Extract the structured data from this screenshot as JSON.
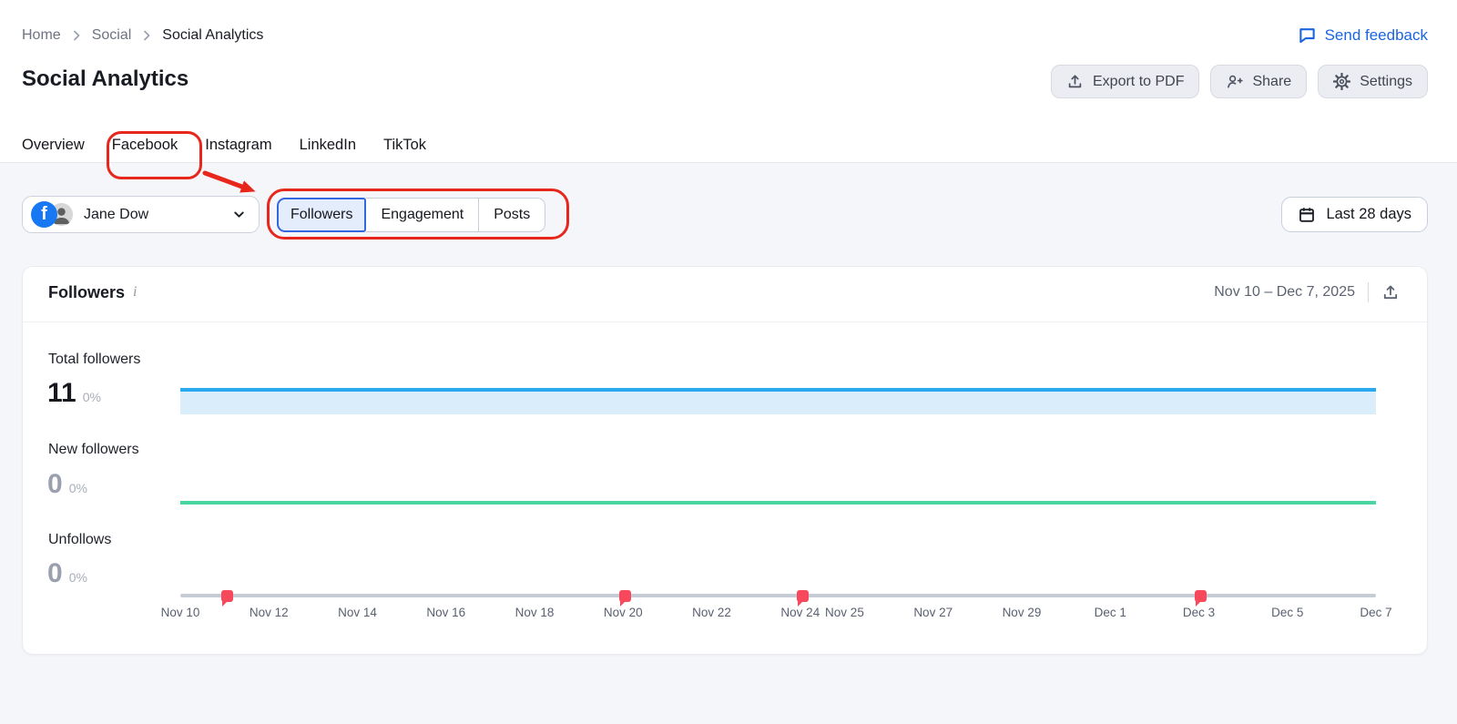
{
  "breadcrumb": {
    "items": [
      "Home",
      "Social",
      "Social Analytics"
    ]
  },
  "feedback": {
    "label": "Send feedback"
  },
  "header": {
    "title": "Social Analytics",
    "actions": [
      {
        "label": "Export to PDF",
        "icon": "export-pdf-icon"
      },
      {
        "label": "Share",
        "icon": "share-person-plus-icon"
      },
      {
        "label": "Settings",
        "icon": "gear-icon"
      }
    ]
  },
  "tabs": {
    "items": [
      {
        "label": "Overview",
        "active": false
      },
      {
        "label": "Facebook",
        "active": true
      },
      {
        "label": "Instagram",
        "active": false
      },
      {
        "label": "LinkedIn",
        "active": false
      },
      {
        "label": "TikTok",
        "active": false
      }
    ]
  },
  "toolbar": {
    "account": {
      "name": "Jane Dow",
      "network": "Facebook"
    },
    "metric_tabs": [
      {
        "label": "Followers",
        "selected": true
      },
      {
        "label": "Engagement",
        "selected": false
      },
      {
        "label": "Posts",
        "selected": false
      }
    ],
    "date_filter": "Last 28 days"
  },
  "annotations": {
    "color": "#e8271c",
    "highlighted": [
      "Facebook tab",
      "Followers | Engagement | Posts toggle"
    ],
    "arrow": "from Facebook tab to metric toggle"
  },
  "card": {
    "title": "Followers",
    "date_range": "Nov 10 – Dec 7, 2025"
  },
  "metrics": [
    {
      "label": "Total followers",
      "value": "11",
      "change": "0%"
    },
    {
      "label": "New followers",
      "value": "0",
      "change": "0%"
    },
    {
      "label": "Unfollows",
      "value": "0",
      "change": "0%"
    }
  ],
  "chart_data": {
    "type": "line",
    "title": "Followers",
    "date_range": "Nov 10 – Dec 7, 2025",
    "x_span_days": 27,
    "x_ticks": [
      {
        "label": "Nov 10",
        "day": 0
      },
      {
        "label": "Nov 12",
        "day": 2
      },
      {
        "label": "Nov 14",
        "day": 4
      },
      {
        "label": "Nov 16",
        "day": 6
      },
      {
        "label": "Nov 18",
        "day": 8
      },
      {
        "label": "Nov 20",
        "day": 10
      },
      {
        "label": "Nov 22",
        "day": 12
      },
      {
        "label": "Nov 24",
        "day": 14
      },
      {
        "label": "Nov 25",
        "day": 15
      },
      {
        "label": "Nov 27",
        "day": 17
      },
      {
        "label": "Nov 29",
        "day": 19
      },
      {
        "label": "Dec 1",
        "day": 21
      },
      {
        "label": "Dec 3",
        "day": 23
      },
      {
        "label": "Dec 5",
        "day": 25
      },
      {
        "label": "Dec 7",
        "day": 27
      }
    ],
    "series": [
      {
        "name": "Total followers",
        "constant_value": 11,
        "change": "0%",
        "color": "#29a9f0",
        "fill_color": "#d9edfb",
        "style": "line-with-area"
      },
      {
        "name": "New followers",
        "constant_value": 0,
        "change": "0%",
        "color": "#49d5a0",
        "style": "line"
      },
      {
        "name": "Unfollows",
        "constant_value": 0,
        "change": "0%",
        "color": "#c7cbd5",
        "style": "baseline"
      }
    ],
    "post_marker_days": [
      1,
      10,
      14,
      23
    ],
    "post_marker_color": "#f8485c",
    "legend": "none",
    "grid": "off"
  },
  "colors": {
    "accent_blue": "#1c64e0",
    "tab_underline": "#2567d9",
    "facebook_blue": "#1877f2",
    "annotation_red": "#e8271c",
    "page_bg": "#f5f6f9",
    "selected_segment_bg": "#e3edfc",
    "selected_segment_border": "#3466dd"
  }
}
